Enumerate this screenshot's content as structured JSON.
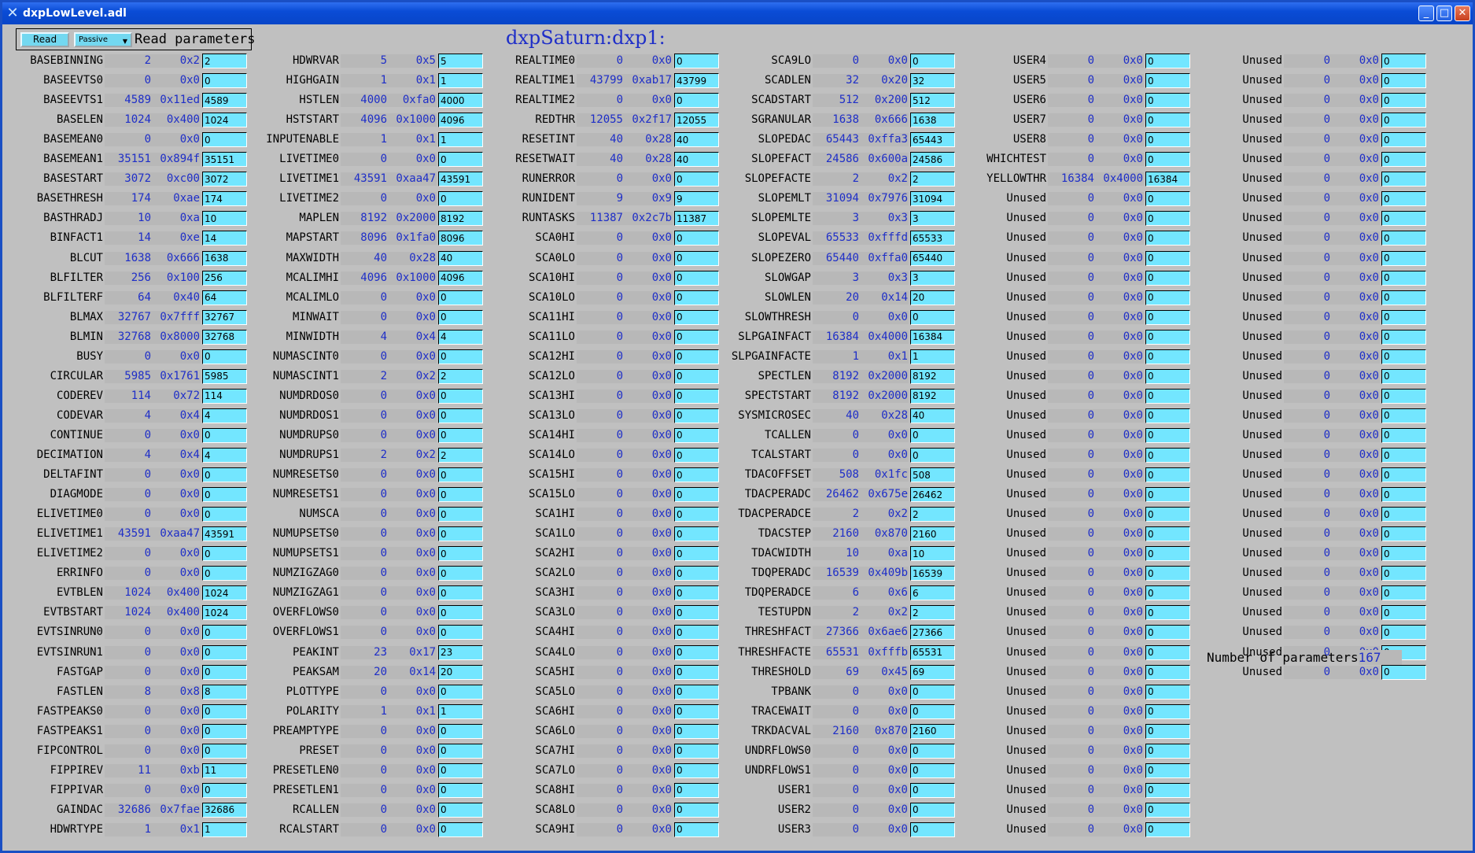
{
  "window": {
    "title": "dxpLowLevel.adl"
  },
  "toolbar": {
    "read_label": "Read",
    "scan_value": "Passive",
    "read_params_label": "Read parameters"
  },
  "heading": "dxpSaturn:dxp1:",
  "param_count": {
    "label": "Number of parameters",
    "value": "167"
  },
  "columns": [
    [
      [
        "BASEBINNING",
        "2",
        "0x2"
      ],
      [
        "BASEEVTS0",
        "0",
        "0x0"
      ],
      [
        "BASEEVTS1",
        "4589",
        "0x11ed"
      ],
      [
        "BASELEN",
        "1024",
        "0x400"
      ],
      [
        "BASEMEAN0",
        "0",
        "0x0"
      ],
      [
        "BASEMEAN1",
        "35151",
        "0x894f"
      ],
      [
        "BASESTART",
        "3072",
        "0xc00"
      ],
      [
        "BASETHRESH",
        "174",
        "0xae"
      ],
      [
        "BASTHRADJ",
        "10",
        "0xa"
      ],
      [
        "BINFACT1",
        "14",
        "0xe"
      ],
      [
        "BLCUT",
        "1638",
        "0x666"
      ],
      [
        "BLFILTER",
        "256",
        "0x100"
      ],
      [
        "BLFILTERF",
        "64",
        "0x40"
      ],
      [
        "BLMAX",
        "32767",
        "0x7fff"
      ],
      [
        "BLMIN",
        "32768",
        "0x8000"
      ],
      [
        "BUSY",
        "0",
        "0x0"
      ],
      [
        "CIRCULAR",
        "5985",
        "0x1761"
      ],
      [
        "CODEREV",
        "114",
        "0x72"
      ],
      [
        "CODEVAR",
        "4",
        "0x4"
      ],
      [
        "CONTINUE",
        "0",
        "0x0"
      ],
      [
        "DECIMATION",
        "4",
        "0x4"
      ],
      [
        "DELTAFINT",
        "0",
        "0x0"
      ],
      [
        "DIAGMODE",
        "0",
        "0x0"
      ],
      [
        "ELIVETIME0",
        "0",
        "0x0"
      ],
      [
        "ELIVETIME1",
        "43591",
        "0xaa47"
      ],
      [
        "ELIVETIME2",
        "0",
        "0x0"
      ],
      [
        "ERRINFO",
        "0",
        "0x0"
      ],
      [
        "EVTBLEN",
        "1024",
        "0x400"
      ],
      [
        "EVTBSTART",
        "1024",
        "0x400"
      ],
      [
        "EVTSINRUN0",
        "0",
        "0x0"
      ],
      [
        "EVTSINRUN1",
        "0",
        "0x0"
      ],
      [
        "FASTGAP",
        "0",
        "0x0"
      ],
      [
        "FASTLEN",
        "8",
        "0x8"
      ],
      [
        "FASTPEAKS0",
        "0",
        "0x0"
      ],
      [
        "FASTPEAKS1",
        "0",
        "0x0"
      ],
      [
        "FIPCONTROL",
        "0",
        "0x0"
      ],
      [
        "FIPPIREV",
        "11",
        "0xb"
      ],
      [
        "FIPPIVAR",
        "0",
        "0x0"
      ],
      [
        "GAINDAC",
        "32686",
        "0x7fae"
      ],
      [
        "HDWRTYPE",
        "1",
        "0x1"
      ]
    ],
    [
      [
        "HDWRVAR",
        "5",
        "0x5"
      ],
      [
        "HIGHGAIN",
        "1",
        "0x1"
      ],
      [
        "HSTLEN",
        "4000",
        "0xfa0"
      ],
      [
        "HSTSTART",
        "4096",
        "0x1000"
      ],
      [
        "INPUTENABLE",
        "1",
        "0x1"
      ],
      [
        "LIVETIME0",
        "0",
        "0x0"
      ],
      [
        "LIVETIME1",
        "43591",
        "0xaa47"
      ],
      [
        "LIVETIME2",
        "0",
        "0x0"
      ],
      [
        "MAPLEN",
        "8192",
        "0x2000"
      ],
      [
        "MAPSTART",
        "8096",
        "0x1fa0"
      ],
      [
        "MAXWIDTH",
        "40",
        "0x28"
      ],
      [
        "MCALIMHI",
        "4096",
        "0x1000"
      ],
      [
        "MCALIMLO",
        "0",
        "0x0"
      ],
      [
        "MINWAIT",
        "0",
        "0x0"
      ],
      [
        "MINWIDTH",
        "4",
        "0x4"
      ],
      [
        "NUMASCINT0",
        "0",
        "0x0"
      ],
      [
        "NUMASCINT1",
        "2",
        "0x2"
      ],
      [
        "NUMDRDOS0",
        "0",
        "0x0"
      ],
      [
        "NUMDRDOS1",
        "0",
        "0x0"
      ],
      [
        "NUMDRUPS0",
        "0",
        "0x0"
      ],
      [
        "NUMDRUPS1",
        "2",
        "0x2"
      ],
      [
        "NUMRESETS0",
        "0",
        "0x0"
      ],
      [
        "NUMRESETS1",
        "0",
        "0x0"
      ],
      [
        "NUMSCA",
        "0",
        "0x0"
      ],
      [
        "NUMUPSETS0",
        "0",
        "0x0"
      ],
      [
        "NUMUPSETS1",
        "0",
        "0x0"
      ],
      [
        "NUMZIGZAG0",
        "0",
        "0x0"
      ],
      [
        "NUMZIGZAG1",
        "0",
        "0x0"
      ],
      [
        "OVERFLOWS0",
        "0",
        "0x0"
      ],
      [
        "OVERFLOWS1",
        "0",
        "0x0"
      ],
      [
        "PEAKINT",
        "23",
        "0x17"
      ],
      [
        "PEAKSAM",
        "20",
        "0x14"
      ],
      [
        "PLOTTYPE",
        "0",
        "0x0"
      ],
      [
        "POLARITY",
        "1",
        "0x1"
      ],
      [
        "PREAMPTYPE",
        "0",
        "0x0"
      ],
      [
        "PRESET",
        "0",
        "0x0"
      ],
      [
        "PRESETLEN0",
        "0",
        "0x0"
      ],
      [
        "PRESETLEN1",
        "0",
        "0x0"
      ],
      [
        "RCALLEN",
        "0",
        "0x0"
      ],
      [
        "RCALSTART",
        "0",
        "0x0"
      ]
    ],
    [
      [
        "REALTIME0",
        "0",
        "0x0"
      ],
      [
        "REALTIME1",
        "43799",
        "0xab17"
      ],
      [
        "REALTIME2",
        "0",
        "0x0"
      ],
      [
        "REDTHR",
        "12055",
        "0x2f17"
      ],
      [
        "RESETINT",
        "40",
        "0x28"
      ],
      [
        "RESETWAIT",
        "40",
        "0x28"
      ],
      [
        "RUNERROR",
        "0",
        "0x0"
      ],
      [
        "RUNIDENT",
        "9",
        "0x9"
      ],
      [
        "RUNTASKS",
        "11387",
        "0x2c7b"
      ],
      [
        "SCA0HI",
        "0",
        "0x0"
      ],
      [
        "SCA0LO",
        "0",
        "0x0"
      ],
      [
        "SCA10HI",
        "0",
        "0x0"
      ],
      [
        "SCA10LO",
        "0",
        "0x0"
      ],
      [
        "SCA11HI",
        "0",
        "0x0"
      ],
      [
        "SCA11LO",
        "0",
        "0x0"
      ],
      [
        "SCA12HI",
        "0",
        "0x0"
      ],
      [
        "SCA12LO",
        "0",
        "0x0"
      ],
      [
        "SCA13HI",
        "0",
        "0x0"
      ],
      [
        "SCA13LO",
        "0",
        "0x0"
      ],
      [
        "SCA14HI",
        "0",
        "0x0"
      ],
      [
        "SCA14LO",
        "0",
        "0x0"
      ],
      [
        "SCA15HI",
        "0",
        "0x0"
      ],
      [
        "SCA15LO",
        "0",
        "0x0"
      ],
      [
        "SCA1HI",
        "0",
        "0x0"
      ],
      [
        "SCA1LO",
        "0",
        "0x0"
      ],
      [
        "SCA2HI",
        "0",
        "0x0"
      ],
      [
        "SCA2LO",
        "0",
        "0x0"
      ],
      [
        "SCA3HI",
        "0",
        "0x0"
      ],
      [
        "SCA3LO",
        "0",
        "0x0"
      ],
      [
        "SCA4HI",
        "0",
        "0x0"
      ],
      [
        "SCA4LO",
        "0",
        "0x0"
      ],
      [
        "SCA5HI",
        "0",
        "0x0"
      ],
      [
        "SCA5LO",
        "0",
        "0x0"
      ],
      [
        "SCA6HI",
        "0",
        "0x0"
      ],
      [
        "SCA6LO",
        "0",
        "0x0"
      ],
      [
        "SCA7HI",
        "0",
        "0x0"
      ],
      [
        "SCA7LO",
        "0",
        "0x0"
      ],
      [
        "SCA8HI",
        "0",
        "0x0"
      ],
      [
        "SCA8LO",
        "0",
        "0x0"
      ],
      [
        "SCA9HI",
        "0",
        "0x0"
      ]
    ],
    [
      [
        "SCA9LO",
        "0",
        "0x0"
      ],
      [
        "SCADLEN",
        "32",
        "0x20"
      ],
      [
        "SCADSTART",
        "512",
        "0x200"
      ],
      [
        "SGRANULAR",
        "1638",
        "0x666"
      ],
      [
        "SLOPEDAC",
        "65443",
        "0xffa3"
      ],
      [
        "SLOPEFACT",
        "24586",
        "0x600a"
      ],
      [
        "SLOPEFACTE",
        "2",
        "0x2"
      ],
      [
        "SLOPEMLT",
        "31094",
        "0x7976"
      ],
      [
        "SLOPEMLTE",
        "3",
        "0x3"
      ],
      [
        "SLOPEVAL",
        "65533",
        "0xfffd"
      ],
      [
        "SLOPEZERO",
        "65440",
        "0xffa0"
      ],
      [
        "SLOWGAP",
        "3",
        "0x3"
      ],
      [
        "SLOWLEN",
        "20",
        "0x14"
      ],
      [
        "SLOWTHRESH",
        "0",
        "0x0"
      ],
      [
        "SLPGAINFACT",
        "16384",
        "0x4000"
      ],
      [
        "SLPGAINFACTE",
        "1",
        "0x1"
      ],
      [
        "SPECTLEN",
        "8192",
        "0x2000"
      ],
      [
        "SPECTSTART",
        "8192",
        "0x2000"
      ],
      [
        "SYSMICROSEC",
        "40",
        "0x28"
      ],
      [
        "TCALLEN",
        "0",
        "0x0"
      ],
      [
        "TCALSTART",
        "0",
        "0x0"
      ],
      [
        "TDACOFFSET",
        "508",
        "0x1fc"
      ],
      [
        "TDACPERADC",
        "26462",
        "0x675e"
      ],
      [
        "TDACPERADCE",
        "2",
        "0x2"
      ],
      [
        "TDACSTEP",
        "2160",
        "0x870"
      ],
      [
        "TDACWIDTH",
        "10",
        "0xa"
      ],
      [
        "TDQPERADC",
        "16539",
        "0x409b"
      ],
      [
        "TDQPERADCE",
        "6",
        "0x6"
      ],
      [
        "TESTUPDN",
        "2",
        "0x2"
      ],
      [
        "THRESHFACT",
        "27366",
        "0x6ae6"
      ],
      [
        "THRESHFACTE",
        "65531",
        "0xfffb"
      ],
      [
        "THRESHOLD",
        "69",
        "0x45"
      ],
      [
        "TPBANK",
        "0",
        "0x0"
      ],
      [
        "TRACEWAIT",
        "0",
        "0x0"
      ],
      [
        "TRKDACVAL",
        "2160",
        "0x870"
      ],
      [
        "UNDRFLOWS0",
        "0",
        "0x0"
      ],
      [
        "UNDRFLOWS1",
        "0",
        "0x0"
      ],
      [
        "USER1",
        "0",
        "0x0"
      ],
      [
        "USER2",
        "0",
        "0x0"
      ],
      [
        "USER3",
        "0",
        "0x0"
      ]
    ],
    [
      [
        "USER4",
        "0",
        "0x0"
      ],
      [
        "USER5",
        "0",
        "0x0"
      ],
      [
        "USER6",
        "0",
        "0x0"
      ],
      [
        "USER7",
        "0",
        "0x0"
      ],
      [
        "USER8",
        "0",
        "0x0"
      ],
      [
        "WHICHTEST",
        "0",
        "0x0"
      ],
      [
        "YELLOWTHR",
        "16384",
        "0x4000"
      ],
      [
        "Unused",
        "0",
        "0x0"
      ],
      [
        "Unused",
        "0",
        "0x0"
      ],
      [
        "Unused",
        "0",
        "0x0"
      ],
      [
        "Unused",
        "0",
        "0x0"
      ],
      [
        "Unused",
        "0",
        "0x0"
      ],
      [
        "Unused",
        "0",
        "0x0"
      ],
      [
        "Unused",
        "0",
        "0x0"
      ],
      [
        "Unused",
        "0",
        "0x0"
      ],
      [
        "Unused",
        "0",
        "0x0"
      ],
      [
        "Unused",
        "0",
        "0x0"
      ],
      [
        "Unused",
        "0",
        "0x0"
      ],
      [
        "Unused",
        "0",
        "0x0"
      ],
      [
        "Unused",
        "0",
        "0x0"
      ],
      [
        "Unused",
        "0",
        "0x0"
      ],
      [
        "Unused",
        "0",
        "0x0"
      ],
      [
        "Unused",
        "0",
        "0x0"
      ],
      [
        "Unused",
        "0",
        "0x0"
      ],
      [
        "Unused",
        "0",
        "0x0"
      ],
      [
        "Unused",
        "0",
        "0x0"
      ],
      [
        "Unused",
        "0",
        "0x0"
      ],
      [
        "Unused",
        "0",
        "0x0"
      ],
      [
        "Unused",
        "0",
        "0x0"
      ],
      [
        "Unused",
        "0",
        "0x0"
      ],
      [
        "Unused",
        "0",
        "0x0"
      ],
      [
        "Unused",
        "0",
        "0x0"
      ],
      [
        "Unused",
        "0",
        "0x0"
      ],
      [
        "Unused",
        "0",
        "0x0"
      ],
      [
        "Unused",
        "0",
        "0x0"
      ],
      [
        "Unused",
        "0",
        "0x0"
      ],
      [
        "Unused",
        "0",
        "0x0"
      ],
      [
        "Unused",
        "0",
        "0x0"
      ],
      [
        "Unused",
        "0",
        "0x0"
      ],
      [
        "Unused",
        "0",
        "0x0"
      ]
    ],
    [
      [
        "Unused",
        "0",
        "0x0"
      ],
      [
        "Unused",
        "0",
        "0x0"
      ],
      [
        "Unused",
        "0",
        "0x0"
      ],
      [
        "Unused",
        "0",
        "0x0"
      ],
      [
        "Unused",
        "0",
        "0x0"
      ],
      [
        "Unused",
        "0",
        "0x0"
      ],
      [
        "Unused",
        "0",
        "0x0"
      ],
      [
        "Unused",
        "0",
        "0x0"
      ],
      [
        "Unused",
        "0",
        "0x0"
      ],
      [
        "Unused",
        "0",
        "0x0"
      ],
      [
        "Unused",
        "0",
        "0x0"
      ],
      [
        "Unused",
        "0",
        "0x0"
      ],
      [
        "Unused",
        "0",
        "0x0"
      ],
      [
        "Unused",
        "0",
        "0x0"
      ],
      [
        "Unused",
        "0",
        "0x0"
      ],
      [
        "Unused",
        "0",
        "0x0"
      ],
      [
        "Unused",
        "0",
        "0x0"
      ],
      [
        "Unused",
        "0",
        "0x0"
      ],
      [
        "Unused",
        "0",
        "0x0"
      ],
      [
        "Unused",
        "0",
        "0x0"
      ],
      [
        "Unused",
        "0",
        "0x0"
      ],
      [
        "Unused",
        "0",
        "0x0"
      ],
      [
        "Unused",
        "0",
        "0x0"
      ],
      [
        "Unused",
        "0",
        "0x0"
      ],
      [
        "Unused",
        "0",
        "0x0"
      ],
      [
        "Unused",
        "0",
        "0x0"
      ],
      [
        "Unused",
        "0",
        "0x0"
      ],
      [
        "Unused",
        "0",
        "0x0"
      ],
      [
        "Unused",
        "0",
        "0x0"
      ],
      [
        "Unused",
        "0",
        "0x0"
      ],
      [
        "Unused",
        "0",
        "0x0"
      ],
      [
        "Unused",
        "0",
        "0x0"
      ]
    ]
  ]
}
